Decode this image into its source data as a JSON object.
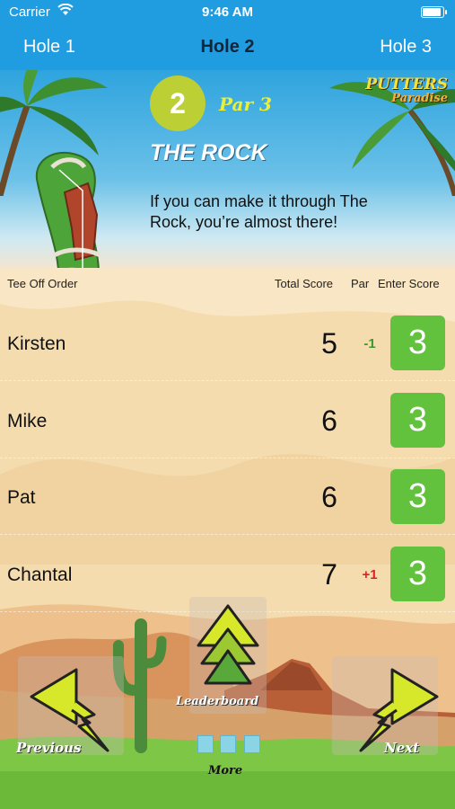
{
  "status": {
    "carrier": "Carrier",
    "time": "9:46 AM"
  },
  "nav": {
    "prev_hole": "Hole 1",
    "current_hole": "Hole 2",
    "next_hole": "Hole 3"
  },
  "hole": {
    "number": "2",
    "par": "Par 3",
    "name": "THE ROCK",
    "description": "If you can make it through The Rock, you’re almost there!"
  },
  "logo": {
    "line1": "PUTTERS",
    "line2": "Paradise"
  },
  "table": {
    "col_order": "Tee Off Order",
    "col_total": "Total Score",
    "col_par": "Par",
    "col_enter": "Enter Score"
  },
  "players": [
    {
      "name": "Kirsten",
      "total": "5",
      "par_diff": "-1",
      "par_color": "#3a9a2a",
      "score": "3"
    },
    {
      "name": "Mike",
      "total": "6",
      "par_diff": "",
      "par_color": "#3a9a2a",
      "score": "3"
    },
    {
      "name": "Pat",
      "total": "6",
      "par_diff": "",
      "par_color": "#3a9a2a",
      "score": "3"
    },
    {
      "name": "Chantal",
      "total": "7",
      "par_diff": "+1",
      "par_color": "#e02020",
      "score": "3"
    }
  ],
  "bottom": {
    "previous": "Previous",
    "next": "Next",
    "leaderboard": "Leaderboard",
    "more": "More"
  },
  "colors": {
    "nav": "#1f9de0",
    "score_button": "#62c23d",
    "hole_badge": "#bccf35",
    "arrow": "#d7e82a"
  }
}
